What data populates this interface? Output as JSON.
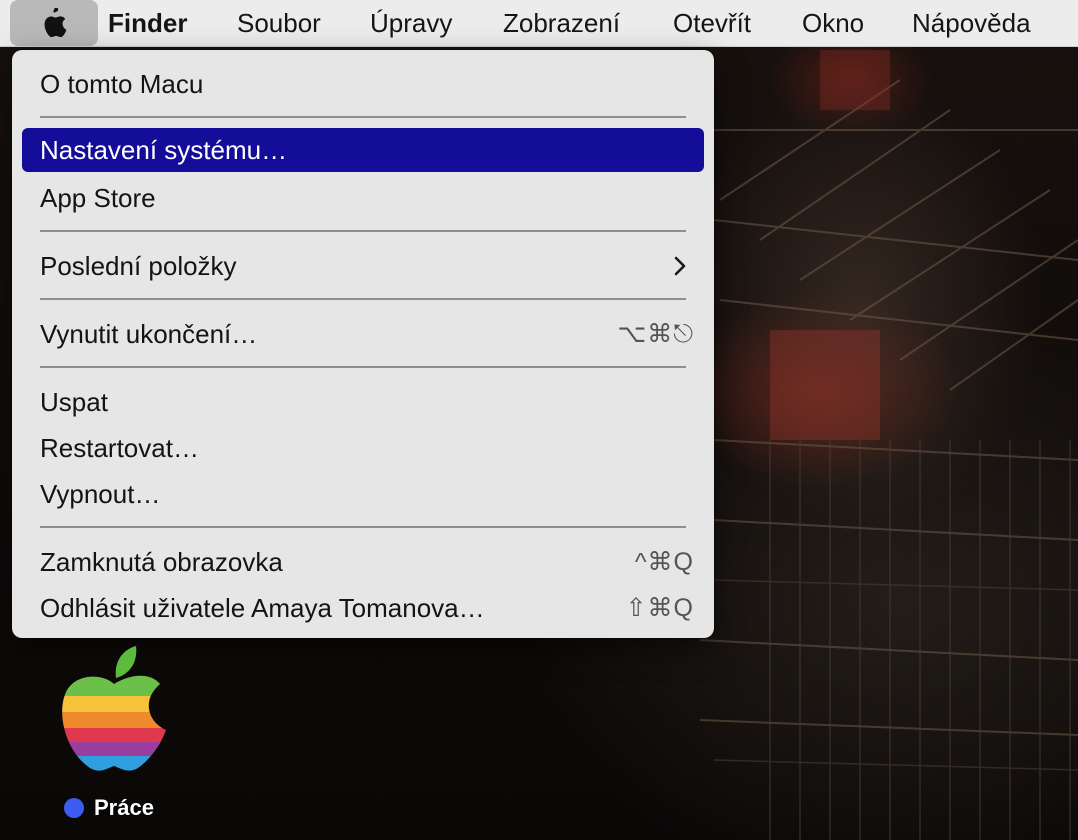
{
  "menubar": {
    "apple_icon": "apple-logo-icon",
    "app_name": "Finder",
    "menus": [
      "Soubor",
      "Úpravy",
      "Zobrazení",
      "Otevřít",
      "Okno",
      "Nápověda"
    ]
  },
  "apple_menu": {
    "items": [
      {
        "label": "O tomto Macu",
        "shortcut": ""
      },
      {
        "label": "Nastavení systému…",
        "shortcut": "",
        "highlighted": true
      },
      {
        "label": "App Store",
        "shortcut": ""
      },
      {
        "label": "Poslední položky",
        "shortcut": "",
        "submenu": true
      },
      {
        "label": "Vynutit ukončení…",
        "shortcut": "⌥⌘⎋"
      },
      {
        "label": "Uspat",
        "shortcut": ""
      },
      {
        "label": "Restartovat…",
        "shortcut": ""
      },
      {
        "label": "Vypnout…",
        "shortcut": ""
      },
      {
        "label": "Zamknutá obrazovka",
        "shortcut": "^⌘Q"
      },
      {
        "label": "Odhlásit uživatele Amaya Tomanova…",
        "shortcut": "⇧⌘Q"
      }
    ]
  },
  "desktop": {
    "icon_name": "rainbow-apple-icon",
    "label": "Práce",
    "tag_color": "#3c5cf0"
  },
  "colors": {
    "highlight": "#140d9a",
    "menu_bg": "#e6e6e6",
    "menubar_bg": "#ececec"
  }
}
